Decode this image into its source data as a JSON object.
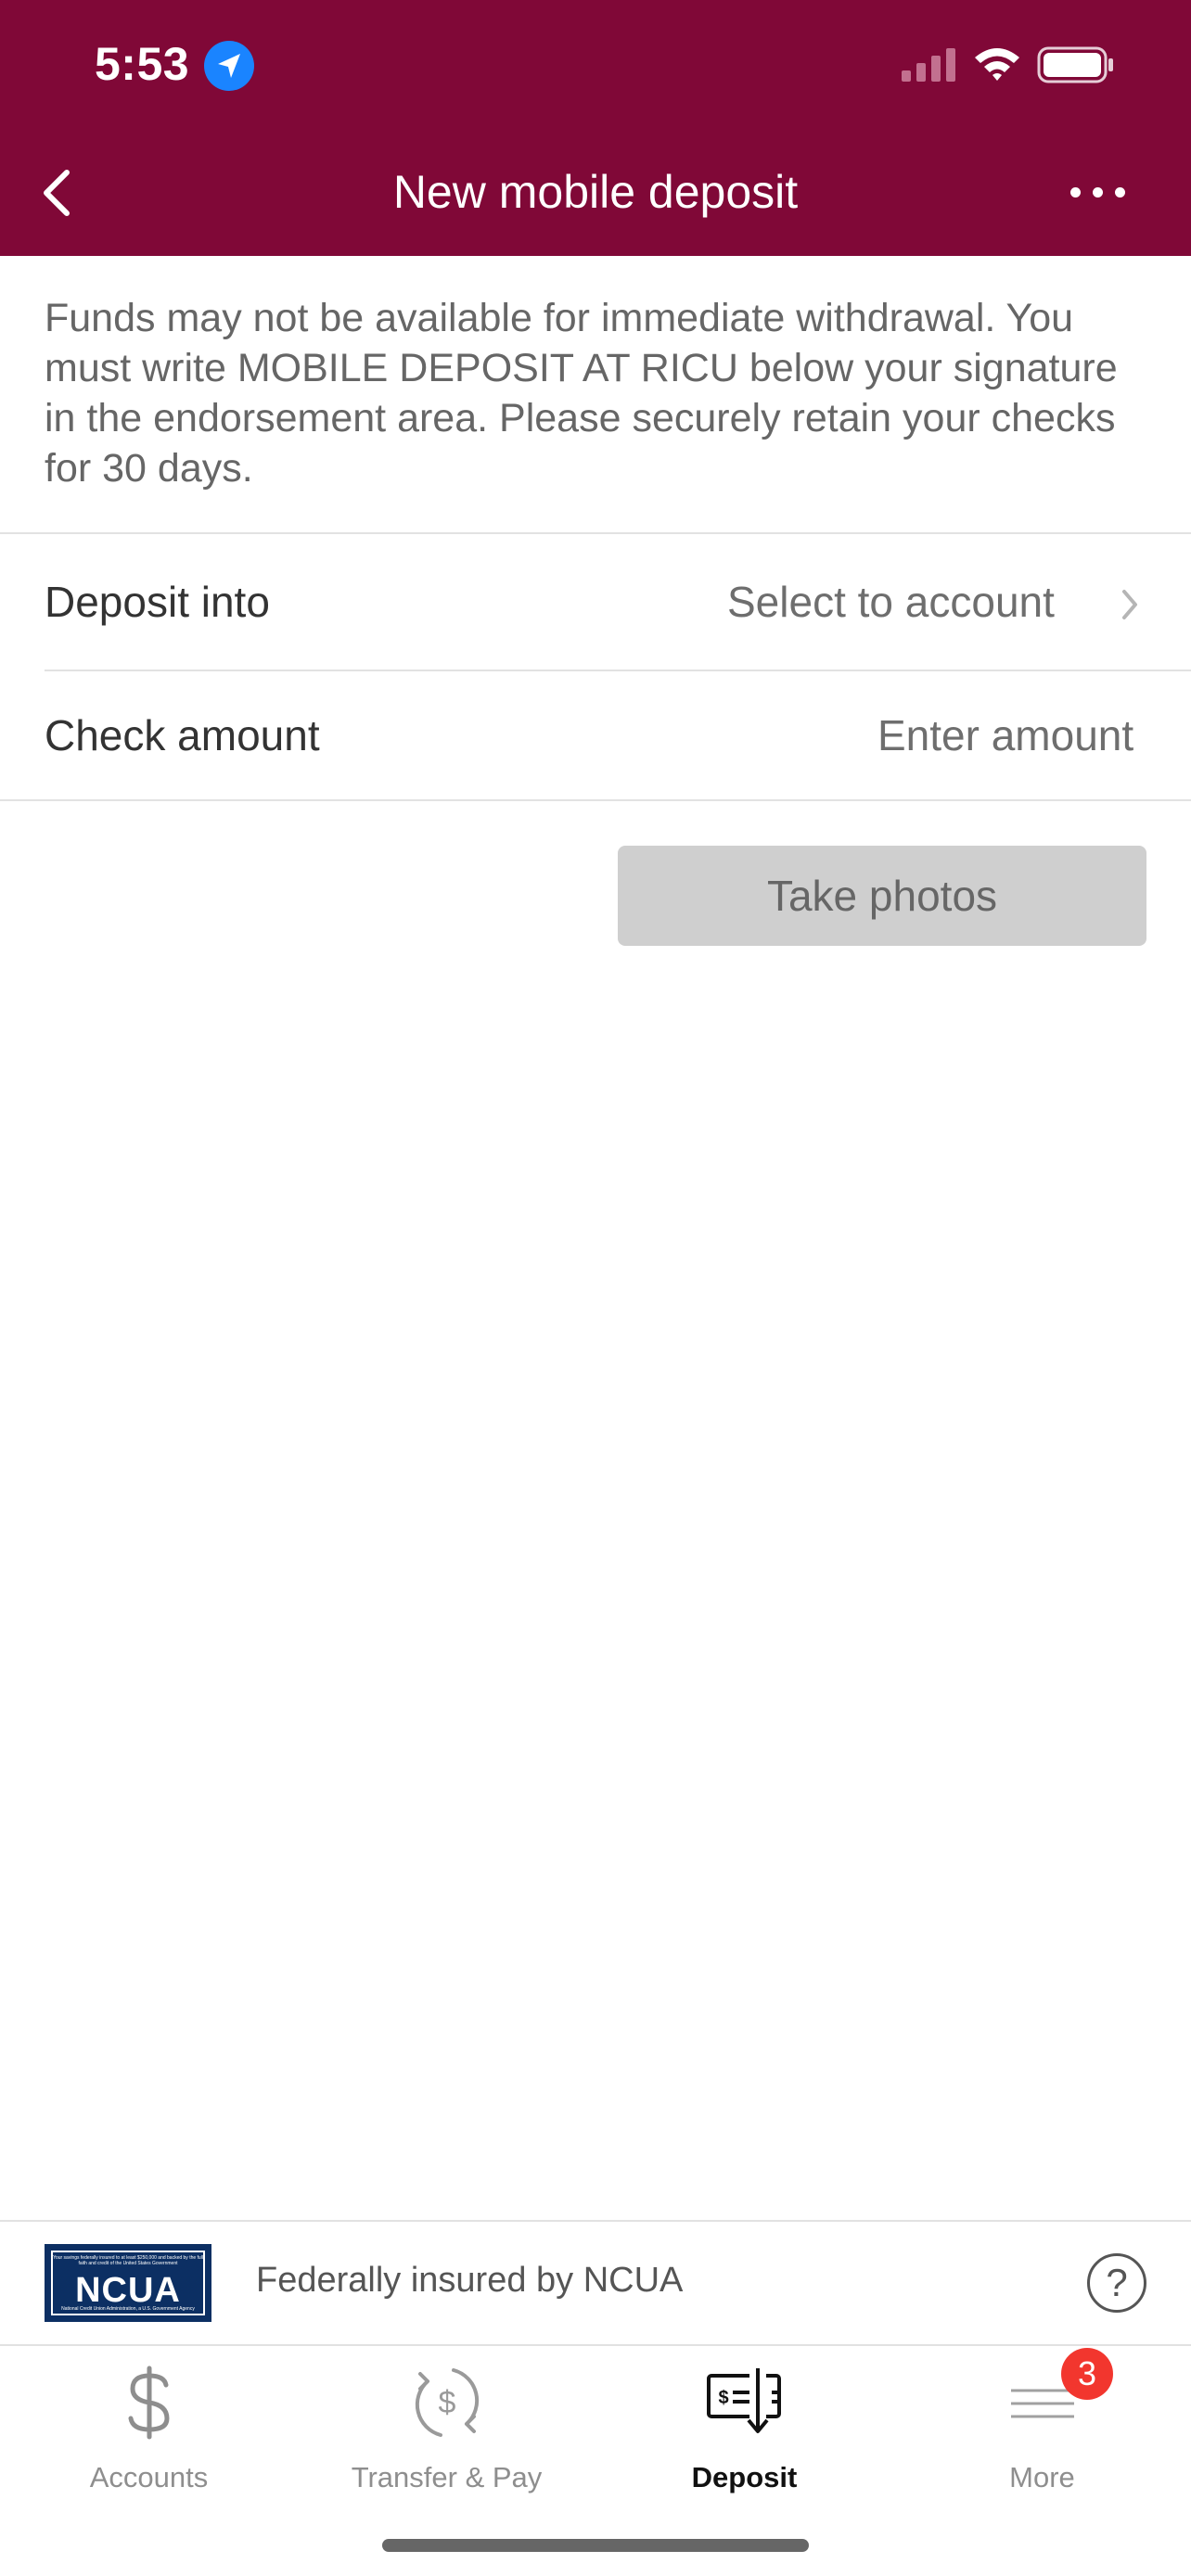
{
  "status_bar": {
    "time": "5:53",
    "icons": [
      "location-arrow-icon",
      "cellular-signal-icon",
      "wifi-icon",
      "battery-icon"
    ]
  },
  "header": {
    "title": "New mobile deposit",
    "background_color": "#800837",
    "back_icon": "chevron-left-icon",
    "more_icon": "ellipsis-icon"
  },
  "notice": {
    "text": "Funds may not be available for immediate withdrawal. You must write MOBILE DEPOSIT AT RICU below your signature in the endorsement area. Please securely retain your checks for 30 days."
  },
  "form": {
    "deposit_into": {
      "label": "Deposit into",
      "value": "Select to account"
    },
    "check_amount": {
      "label": "Check amount",
      "placeholder": "Enter amount",
      "value": ""
    },
    "take_photos_label": "Take photos"
  },
  "insurance": {
    "logo_text": "NCUA",
    "logo_fine_print_top": "Your savings federally insured to at least $250,000 and backed by the full faith and credit of the United States Government",
    "logo_fine_print_bottom": "National Credit Union Administration, a U.S. Government Agency",
    "text": "Federally insured by NCUA",
    "help_icon": "question-circle-icon"
  },
  "tabs": [
    {
      "label": "Accounts",
      "icon": "dollar-icon",
      "active": false
    },
    {
      "label": "Transfer & Pay",
      "icon": "transfer-dollar-icon",
      "active": false
    },
    {
      "label": "Deposit",
      "icon": "check-deposit-icon",
      "active": true
    },
    {
      "label": "More",
      "icon": "menu-lines-icon",
      "active": false,
      "badge": "3"
    }
  ]
}
